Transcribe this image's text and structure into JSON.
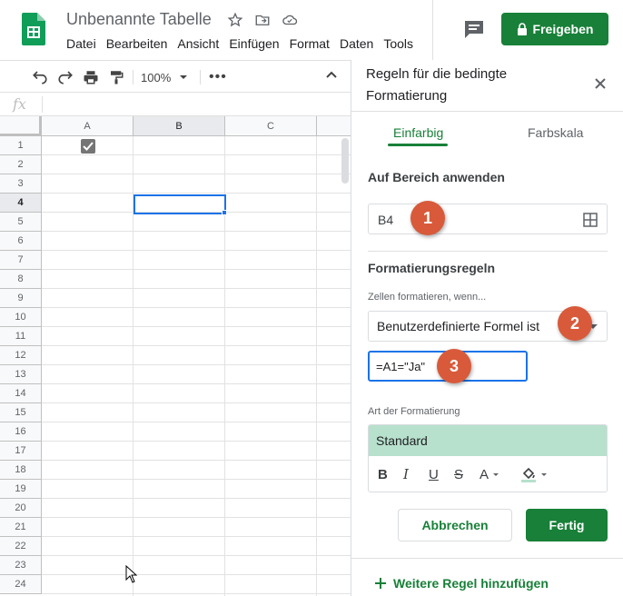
{
  "app": {
    "doc_title": "Unbenannte Tabelle",
    "menu": [
      "Datei",
      "Bearbeiten",
      "Ansicht",
      "Einfügen",
      "Format",
      "Daten",
      "Tools"
    ],
    "share_label": "Freigeben"
  },
  "toolbar": {
    "zoom": "100%"
  },
  "formula_bar": {
    "fx": "fx"
  },
  "grid": {
    "columns": [
      "A",
      "B",
      "C"
    ],
    "rows": [
      "1",
      "2",
      "3",
      "4",
      "5",
      "6",
      "7",
      "8",
      "9",
      "10",
      "11",
      "12",
      "13",
      "14",
      "15",
      "16",
      "17",
      "18",
      "19",
      "20",
      "21",
      "22",
      "23",
      "24"
    ],
    "active_column": "B",
    "active_row": "4",
    "checked_cell": "A1"
  },
  "panel": {
    "title": "Regeln für die bedingte Formatierung",
    "tabs": [
      "Einfarbig",
      "Farbskala"
    ],
    "range_label": "Auf Bereich anwenden",
    "range_value": "B4",
    "rules_label": "Formatierungsregeln",
    "condition_label": "Zellen formatieren, wenn...",
    "condition_value": "Benutzerdefinierte Formel ist",
    "formula_value": "=A1=\"Ja\"",
    "style_label": "Art der Formatierung",
    "style_preview": "Standard",
    "format_buttons": [
      "B",
      "I",
      "U",
      "S",
      "A"
    ],
    "cancel_label": "Abbrechen",
    "done_label": "Fertig",
    "add_rule_label": "Weitere Regel hinzufügen"
  },
  "markers": [
    "1",
    "2",
    "3"
  ],
  "colors": {
    "accent_green": "#188038",
    "style_fill": "#b7e1cd",
    "marker": "#d85a3a",
    "selection_blue": "#1a73e8"
  }
}
